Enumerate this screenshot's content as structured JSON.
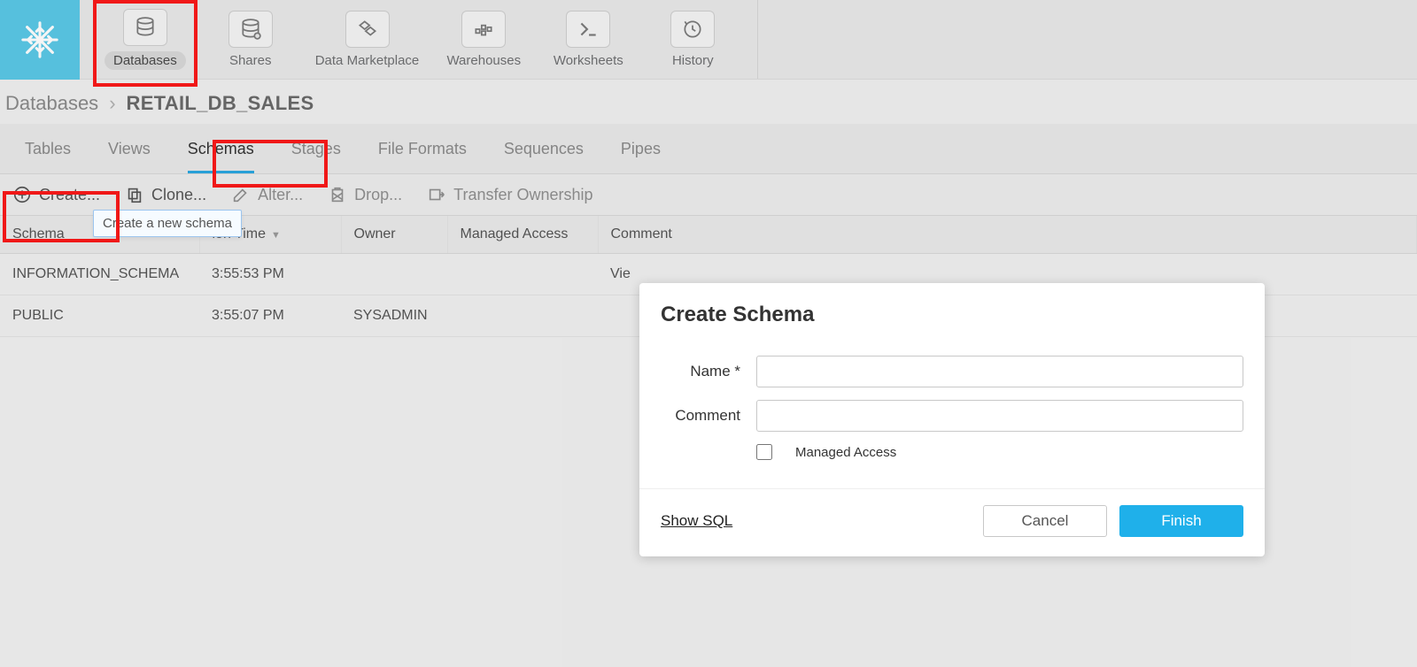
{
  "nav": {
    "items": [
      {
        "label": "Databases",
        "icon": "database",
        "active": true
      },
      {
        "label": "Shares",
        "icon": "share",
        "active": false
      },
      {
        "label": "Data Marketplace",
        "icon": "marketplace",
        "active": false
      },
      {
        "label": "Warehouses",
        "icon": "warehouse",
        "active": false
      },
      {
        "label": "Worksheets",
        "icon": "worksheet",
        "active": false
      },
      {
        "label": "History",
        "icon": "history",
        "active": false
      }
    ]
  },
  "breadcrumb": {
    "root": "Databases",
    "db": "RETAIL_DB_SALES"
  },
  "obj_tabs": [
    {
      "label": "Tables",
      "active": false
    },
    {
      "label": "Views",
      "active": false
    },
    {
      "label": "Schemas",
      "active": true
    },
    {
      "label": "Stages",
      "active": false
    },
    {
      "label": "File Formats",
      "active": false
    },
    {
      "label": "Sequences",
      "active": false
    },
    {
      "label": "Pipes",
      "active": false
    }
  ],
  "actions": {
    "create": "Create...",
    "clone": "Clone...",
    "alter": "Alter...",
    "drop": "Drop...",
    "transfer": "Transfer Ownership"
  },
  "tooltip": "Create a new schema",
  "table": {
    "headers": {
      "schema": "Schema",
      "time": "ion Time",
      "owner": "Owner",
      "managed": "Managed Access",
      "comment": "Comment"
    },
    "rows": [
      {
        "schema": "INFORMATION_SCHEMA",
        "time": "3:55:53 PM",
        "owner": "",
        "managed": "",
        "comment": "Vie"
      },
      {
        "schema": "PUBLIC",
        "time": "3:55:07 PM",
        "owner": "SYSADMIN",
        "managed": "",
        "comment": ""
      }
    ]
  },
  "dialog": {
    "title": "Create Schema",
    "name_label": "Name *",
    "name_value": "",
    "comment_label": "Comment",
    "comment_value": "",
    "managed_label": "Managed Access",
    "show_sql": "Show SQL",
    "cancel": "Cancel",
    "finish": "Finish"
  }
}
